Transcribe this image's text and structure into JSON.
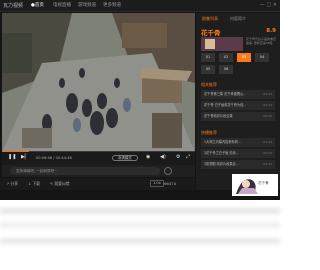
{
  "app": {
    "logo": "瓦力视频",
    "window_controls": "— □ ✕"
  },
  "tabs": [
    {
      "label": "●首页",
      "active": true
    },
    {
      "label": "电视直播",
      "active": false
    },
    {
      "label": "游戏频道",
      "active": false
    },
    {
      "label": "更多频道",
      "active": false
    }
  ],
  "player": {
    "time": "00:06:06 / 00:44:46",
    "quality": "标清模式",
    "progress": 0.14,
    "play_icon": "pause-icon"
  },
  "comment": {
    "placeholder": "发条弹幕吧, 一起刷屏吧~"
  },
  "actions": {
    "share": "分享",
    "download": "下载",
    "report": "我要纠错",
    "speed": "1.0x",
    "count": "66474"
  },
  "side": {
    "tabs": [
      {
        "label": "剧集列表",
        "active": true
      },
      {
        "label": "内容简介",
        "active": false
      }
    ],
    "title": "花千骨",
    "rating": "8.9",
    "description": "花千骨与白子画的虐恋故事, 更新至第58集",
    "episodes": [
      "01",
      "02",
      "03",
      "04",
      "05",
      "06"
    ],
    "current_episode": "03",
    "related_title": "相关推荐",
    "related": [
      {
        "title": "花千骨第三集 花千骨被蜀山...",
        "meta": "02:34"
      },
      {
        "title": "花千骨 白子画收花千骨为徒...",
        "meta": "03:12"
      },
      {
        "title": "花千骨精彩片段合集",
        "meta": "05:40"
      }
    ],
    "popular_title": "热播推荐",
    "popular": [
      {
        "title": "1大神之内幕内容看你看...",
        "meta": "01:34"
      },
      {
        "title": "2花千骨之白子画 情深...",
        "meta": "02:20"
      },
      {
        "title": "3影视剧 精彩片段集合...",
        "meta": "04:10"
      }
    ],
    "mascot_label": "花千骨"
  }
}
